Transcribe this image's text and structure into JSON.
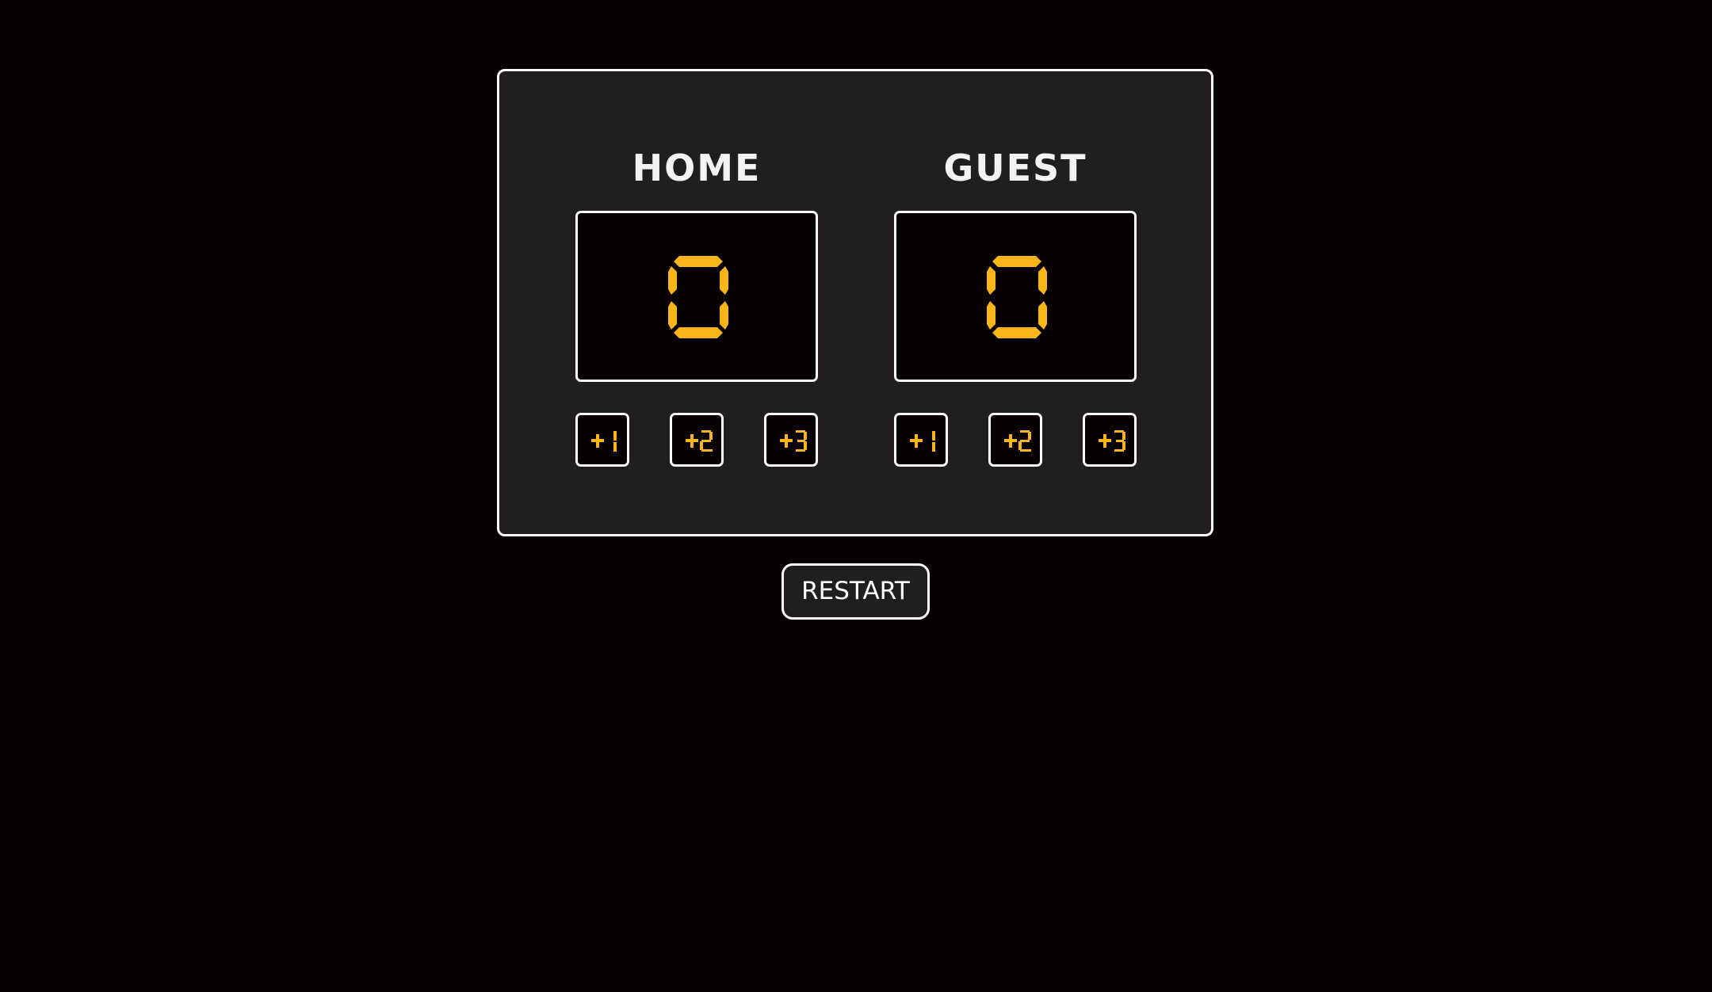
{
  "colors": {
    "background": "#070102",
    "panel": "#201e1e",
    "border": "#ffffff",
    "digit": "#f8b51a",
    "text": "#f4f2f2"
  },
  "home": {
    "name": "HOME",
    "score": "0",
    "buttons": [
      "+1",
      "+2",
      "+3"
    ]
  },
  "guest": {
    "name": "GUEST",
    "score": "0",
    "buttons": [
      "+1",
      "+2",
      "+3"
    ]
  },
  "restart_label": "RESTART"
}
